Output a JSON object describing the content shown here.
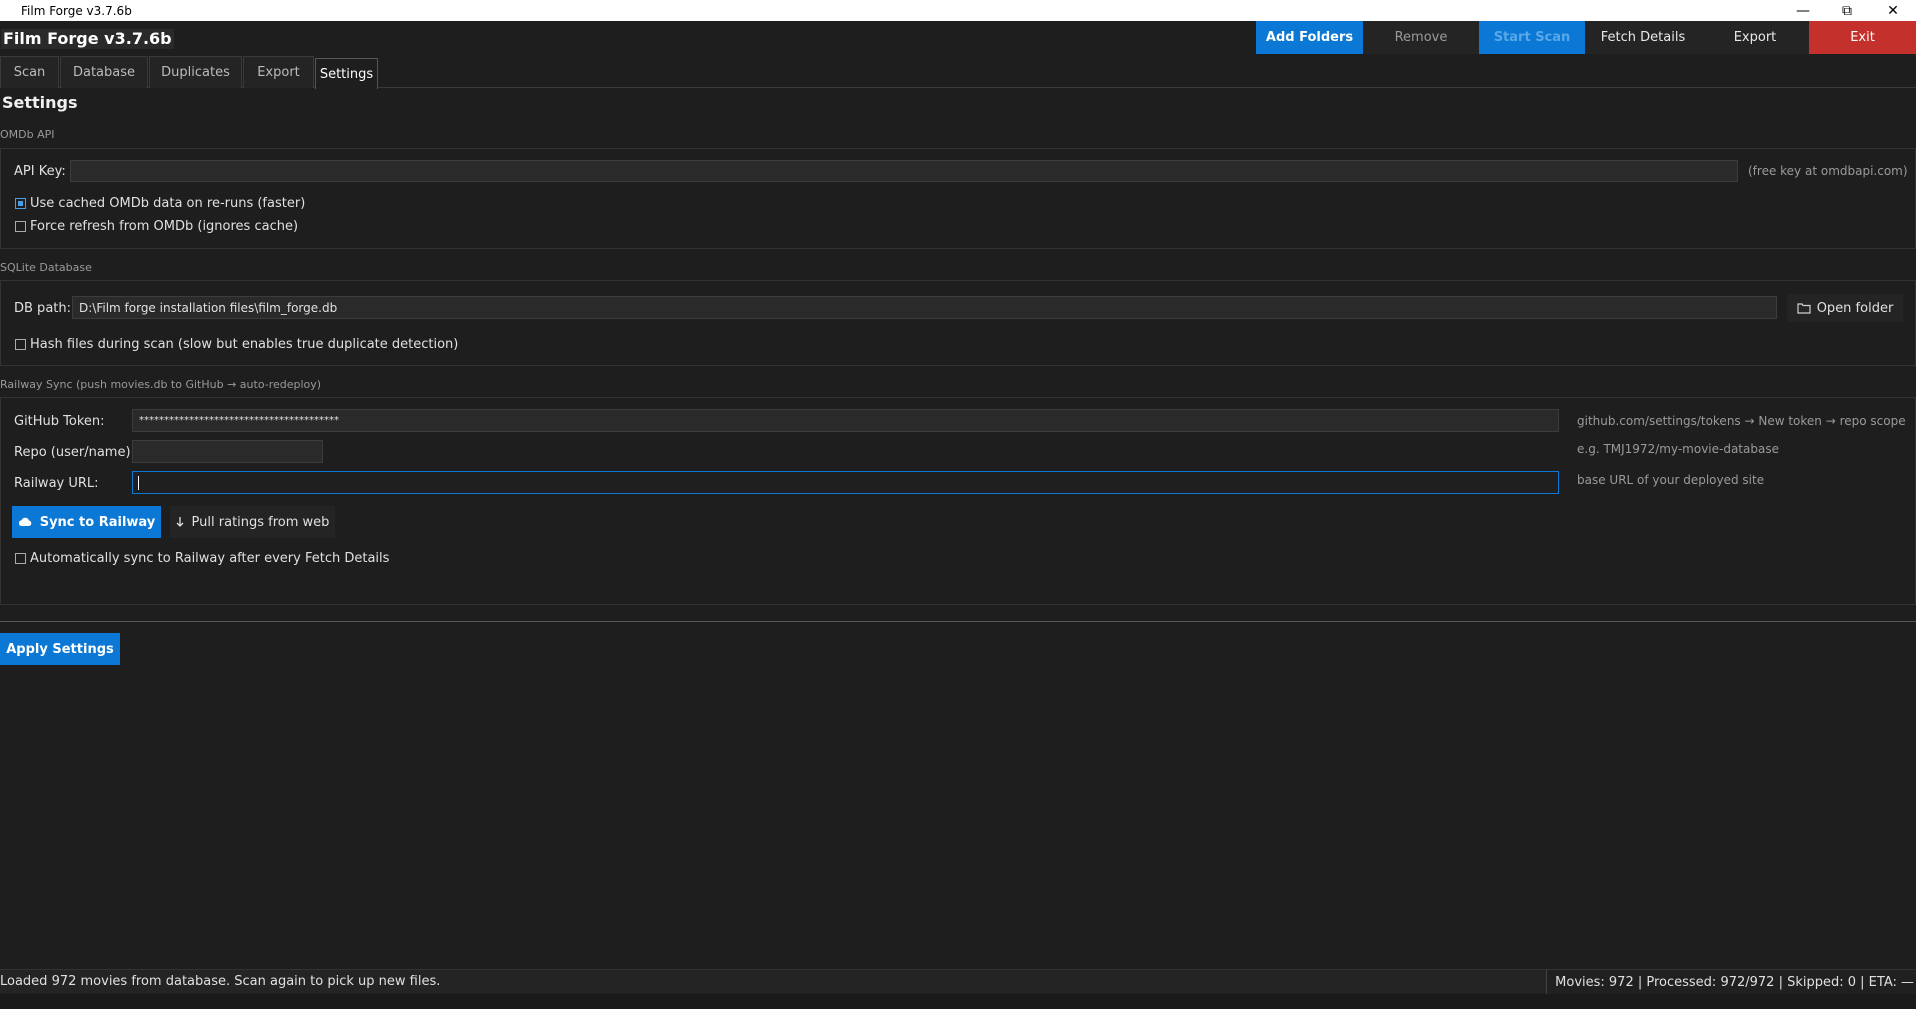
{
  "window": {
    "title": "Film Forge  v3.7.6b",
    "minimize_glyph": "—",
    "maximize_glyph": "⧉",
    "close_glyph": "✕"
  },
  "app": {
    "title": "Film Forge  v3.7.6b"
  },
  "toolbar": {
    "add_folders": "Add Folders",
    "remove": "Remove",
    "start_scan": "Start Scan",
    "fetch_details": "Fetch Details",
    "export": "Export",
    "exit": "Exit"
  },
  "tabs": [
    {
      "label": "Scan"
    },
    {
      "label": "Database"
    },
    {
      "label": "Duplicates"
    },
    {
      "label": "Export"
    },
    {
      "label": "Settings",
      "active": true
    }
  ],
  "settings": {
    "heading": "Settings",
    "omdb": {
      "group_label": "OMDb API",
      "api_key_label": "API Key:",
      "api_key_value": "",
      "api_key_hint": "(free key at omdbapi.com)",
      "use_cached_label": "Use cached OMDb data on re-runs (faster)",
      "use_cached_checked": true,
      "force_refresh_label": "Force refresh from OMDb (ignores cache)",
      "force_refresh_checked": false
    },
    "sqlite": {
      "group_label": "SQLite Database",
      "db_path_label": "DB path:",
      "db_path_value": "D:\\Film forge installation files\\film_forge.db",
      "open_folder_label": "Open folder",
      "hash_files_label": "Hash files during scan (slow but enables true duplicate detection)",
      "hash_files_checked": false
    },
    "railway": {
      "group_label": "Railway Sync  (push movies.db to GitHub → auto-redeploy)",
      "github_token_label": "GitHub Token:",
      "github_token_value": "****************************************",
      "github_token_hint": "github.com/settings/tokens → New token → repo scope",
      "repo_label": "Repo (user/name):",
      "repo_value": "",
      "repo_hint": "e.g. TMJ1972/my-movie-database",
      "railway_url_label": "Railway URL:",
      "railway_url_value": "",
      "railway_url_hint": "base URL of your deployed site",
      "sync_button": "Sync to Railway",
      "pull_button": "Pull ratings from web",
      "auto_sync_label": "Automatically sync to Railway after every Fetch Details",
      "auto_sync_checked": false
    },
    "apply_button": "Apply Settings"
  },
  "status": {
    "message": "Loaded 972 movies from database. Scan again to pick up new files.",
    "stats": "Movies: 972  |  Processed: 972/972  |  Skipped: 0  |  ETA: —"
  },
  "colors": {
    "accent": "#0a78d4",
    "exit": "#c4302b",
    "background": "#1e1e1e"
  },
  "icons": {
    "open_folder": "folder-icon",
    "sync": "cloud-icon",
    "pull": "download-arrow-icon"
  }
}
